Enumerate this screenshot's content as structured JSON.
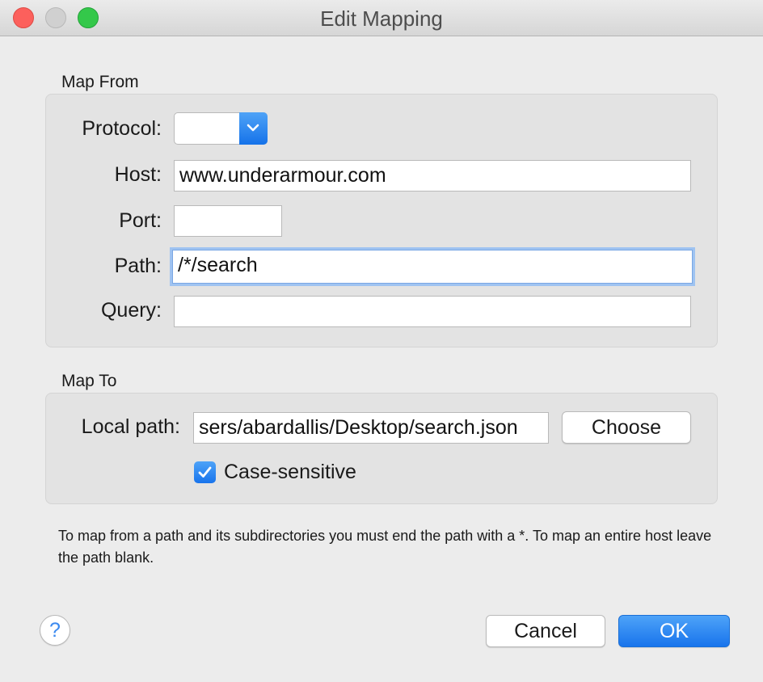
{
  "window": {
    "title": "Edit Mapping"
  },
  "map_from": {
    "section_label": "Map From",
    "protocol": {
      "label": "Protocol:",
      "value": ""
    },
    "host": {
      "label": "Host:",
      "value": "www.underarmour.com"
    },
    "port": {
      "label": "Port:",
      "value": ""
    },
    "path": {
      "label": "Path:",
      "value": "/*/search"
    },
    "query": {
      "label": "Query:",
      "value": ""
    }
  },
  "map_to": {
    "section_label": "Map To",
    "local_path": {
      "label": "Local path:",
      "value": "sers/abardallis/Desktop/search.json"
    },
    "choose_label": "Choose",
    "case_sensitive": {
      "label": "Case-sensitive",
      "checked": true
    }
  },
  "hint": "To map from a path and its subdirectories you must end the path with a *. To map an entire host leave the path blank.",
  "footer": {
    "help_label": "?",
    "cancel_label": "Cancel",
    "ok_label": "OK"
  },
  "colors": {
    "accent": "#1874ec",
    "focus_ring": "#9fc3f1",
    "close": "#fc605c",
    "zoom": "#34c84a"
  }
}
